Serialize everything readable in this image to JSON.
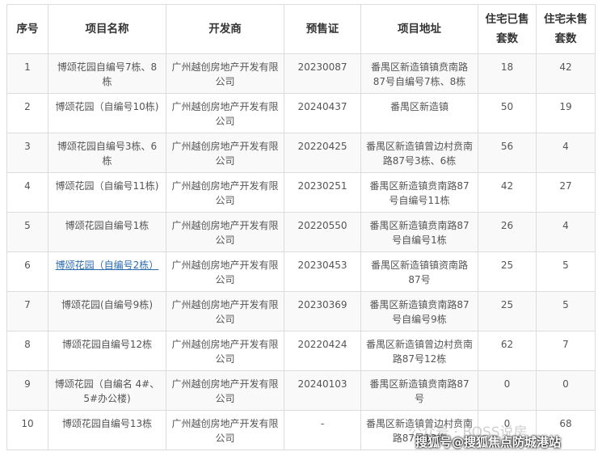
{
  "headers": [
    "序号",
    "项目名称",
    "开发商",
    "预售证",
    "项目地址",
    "住宅已售套数",
    "住宅未售套数"
  ],
  "rows": [
    {
      "no": "1",
      "name": "博颂花园自编号7栋、8栋",
      "dev": "广州越创房地产开发有限公司",
      "permit": "20230087",
      "addr": "番禺区新造镇镇贲南路87号自编号7栋、8栋",
      "sold": "18",
      "unsold": "42"
    },
    {
      "no": "2",
      "name": "博颂花园（自编号10栋)",
      "dev": "广州越创房地产开发有限公司",
      "permit": "20240437",
      "addr": "番禺区新造镇",
      "sold": "50",
      "unsold": "19"
    },
    {
      "no": "3",
      "name": "博颂花园自编号3栋、6栋",
      "dev": "广州越创房地产开发有限公司",
      "permit": "20220425",
      "addr": "番禺区新造镇曾边村贲南路87号3栋、6栋",
      "sold": "56",
      "unsold": "4"
    },
    {
      "no": "4",
      "name": "博颂花园（自编号11栋)",
      "dev": "广州越创房地产开发有限公司",
      "permit": "20230251",
      "addr": "番禺区新造镇贲南路87号自编号11栋",
      "sold": "42",
      "unsold": "27"
    },
    {
      "no": "5",
      "name": "博颂花园自编号1栋",
      "dev": "广州越创房地产开发有限公司",
      "permit": "20220550",
      "addr": "番禺区新造镇贲南路87号自编号1栋",
      "sold": "26",
      "unsold": "4"
    },
    {
      "no": "6",
      "name": "博颂花园（自编号2栋）",
      "dev": "广州越创房地产开发有限公司",
      "permit": "20230453",
      "addr": "番禺区新造镇镇资南路87号",
      "sold": "25",
      "unsold": "5"
    },
    {
      "no": "7",
      "name": "博颂花园(自编号9栋)",
      "dev": "广州越创房地产开发有限公司",
      "permit": "20230369",
      "addr": "番禺区新造镇贲南路87号自编号9栋",
      "sold": "25",
      "unsold": "5"
    },
    {
      "no": "8",
      "name": "博颂花园自编号12栋",
      "dev": "广州越创房地产开发有限公司",
      "permit": "20220424",
      "addr": "番禺区新造镇曾边村贲南路87号12栋",
      "sold": "62",
      "unsold": "7"
    },
    {
      "no": "9",
      "name": "博颂花园（自编名 4#、5#办公楼)",
      "dev": "广州越创房地产开发有限公司",
      "permit": "20240103",
      "addr": "番禺区新造镇贲南路87号",
      "sold": "0",
      "unsold": "0"
    },
    {
      "no": "10",
      "name": "博颂花园自编号13栋",
      "dev": "广州越创房地产开发有限公司",
      "permit": "-",
      "addr": "番禺区新造镇曾边村贲南路87号13栋",
      "sold": "0",
      "unsold": "68"
    }
  ],
  "watermark": {
    "faint": "公众号 · BOSS说房",
    "main": "搜狐号@搜狐焦点防城港站"
  }
}
